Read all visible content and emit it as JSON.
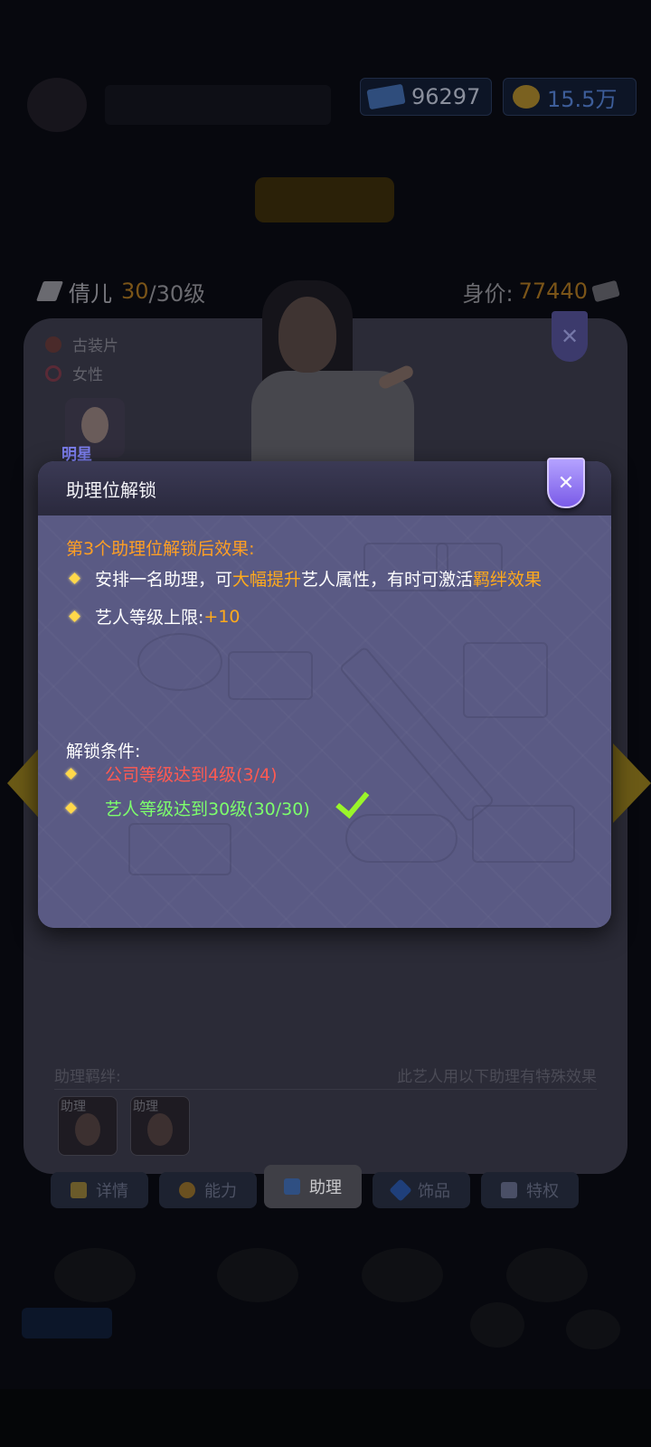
{
  "top_bar": {
    "cash_value": "96297",
    "gold_value": "15.5万"
  },
  "artist": {
    "name": "倩儿",
    "level_current": "30",
    "level_max": "/30级",
    "worth_label": "身价:",
    "worth_value": "77440",
    "tags": [
      "古装片",
      "女性"
    ],
    "star_label": "明星"
  },
  "bond_section": {
    "label": "助理羁绊:",
    "note": "此艺人用以下助理有特殊效果",
    "helper_cards": [
      "助理",
      "助理"
    ]
  },
  "tabs": [
    {
      "label": "详情",
      "icon": "document-icon",
      "active": false
    },
    {
      "label": "能力",
      "icon": "ability-icon",
      "active": false
    },
    {
      "label": "助理",
      "icon": "assistant-icon",
      "active": true
    },
    {
      "label": "饰品",
      "icon": "diamond-icon",
      "active": false
    },
    {
      "label": "特权",
      "icon": "megaphone-icon",
      "active": false
    }
  ],
  "dialog": {
    "title": "助理位解锁",
    "effect_title": "第3个助理位解锁后效果:",
    "effect_1": {
      "part1": "安排一名助理，可",
      "highlight1": "大幅提升",
      "part2": "艺人属性，有时可激活",
      "highlight2": "羁绊效果"
    },
    "effect_2": {
      "text": "艺人等级上限:",
      "value": "+10"
    },
    "conditions_title": "解锁条件:",
    "conditions": [
      {
        "text": "公司等级达到4级(3/4)",
        "met": false
      },
      {
        "text": "艺人等级达到30级(30/30)",
        "met": true
      }
    ],
    "close_symbol": "✕"
  },
  "colors": {
    "accent_orange": "#ffaa1c",
    "fail_red": "#ff5a52",
    "ok_green": "#7dff6c",
    "dialog_bg": "#5a5a84",
    "close_purple": "#7a5be8"
  }
}
